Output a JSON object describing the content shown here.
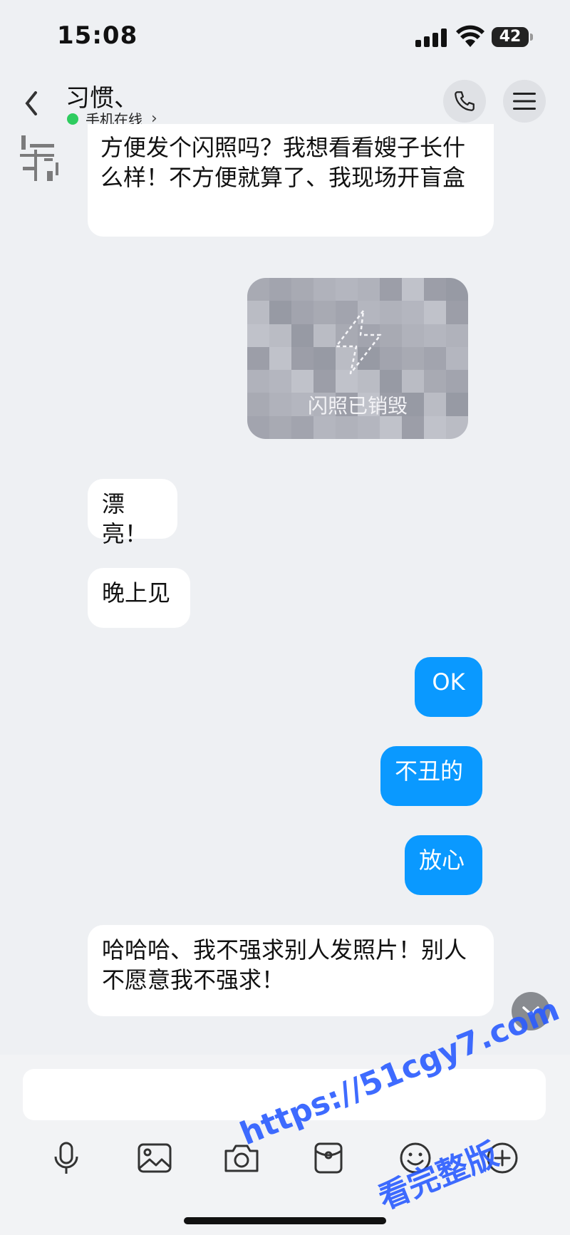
{
  "status_bar": {
    "time": "15:08",
    "battery": "42"
  },
  "header": {
    "contact_name": "习惯、",
    "status": "手机在线",
    "status_color": "#2ecc5f"
  },
  "messages": [
    {
      "side": "incoming",
      "text": "方便发个闪照吗？我想看看嫂子长什么样！不方便就算了、我现场开盲盒"
    },
    {
      "side": "outgoing",
      "type": "flash_photo",
      "label": "闪照已销毁"
    },
    {
      "side": "incoming",
      "text": "漂亮！"
    },
    {
      "side": "incoming",
      "text": "晚上见"
    },
    {
      "side": "outgoing",
      "text": "OK"
    },
    {
      "side": "outgoing",
      "text": "不丑的"
    },
    {
      "side": "outgoing",
      "text": "放心"
    },
    {
      "side": "incoming",
      "text": "哈哈哈、我不强求别人发照片！别人不愿意我不强求！"
    }
  ],
  "colors": {
    "outgoing_bubble": "#0a99ff",
    "incoming_bubble": "#ffffff",
    "background": "#eef0f3"
  },
  "toolbar": {
    "icons": [
      "microphone-icon",
      "image-icon",
      "camera-icon",
      "red-packet-icon",
      "emoji-icon",
      "plus-icon"
    ]
  },
  "watermark": {
    "line1": "https://51cgy7.com",
    "line2": "看完整版"
  }
}
